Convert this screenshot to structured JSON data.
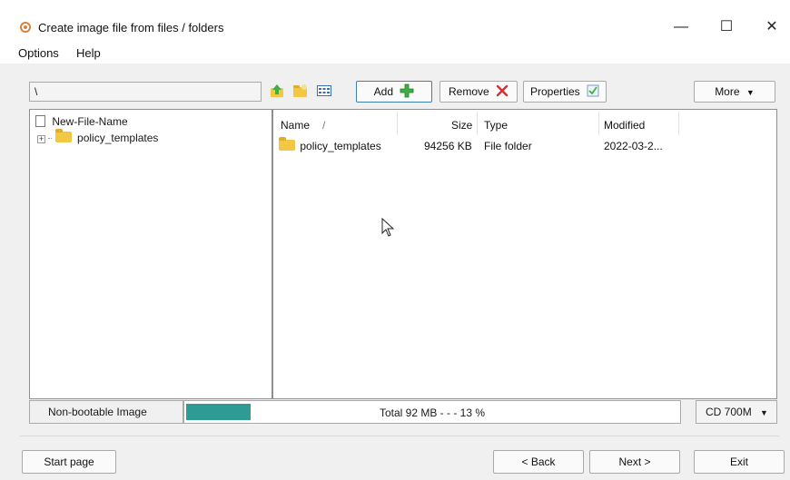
{
  "window": {
    "title": "Create image file from files / folders",
    "minimize": "—",
    "maximize": "☐",
    "close": "✕"
  },
  "menu": {
    "items": [
      "Options",
      "Help"
    ]
  },
  "toolbar": {
    "path_value": "\\",
    "add_label": "Add",
    "remove_label": "Remove",
    "properties_label": "Properties",
    "more_label": "More"
  },
  "tree": {
    "root": "New-File-Name",
    "children": [
      "policy_templates"
    ]
  },
  "list": {
    "columns": {
      "name": "Name",
      "sort_indicator": "/",
      "size": "Size",
      "type": "Type",
      "modified": "Modified"
    },
    "rows": [
      {
        "name": "policy_templates",
        "size": "94256 KB",
        "type": "File folder",
        "modified": "2022-03-2..."
      }
    ]
  },
  "status": {
    "image_type": "Non-bootable Image",
    "progress_text": "Total  92 MB   - - -  13 %",
    "progress_fraction": 0.13,
    "media": "CD 700M"
  },
  "footer": {
    "start_page": "Start page",
    "back": "< Back",
    "next": "Next >",
    "exit": "Exit"
  },
  "colors": {
    "progress": "#2e9b95",
    "add_green": "#3cb043",
    "remove_red": "#d63031"
  }
}
